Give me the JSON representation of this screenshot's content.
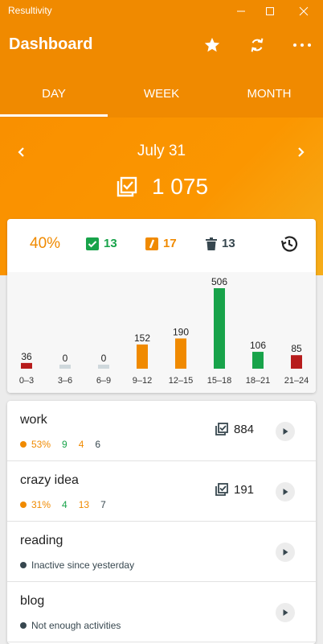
{
  "window": {
    "title": "Resultivity"
  },
  "header": {
    "title": "Dashboard",
    "actions": [
      "star-icon",
      "sync-icon",
      "more-icon"
    ]
  },
  "tabs": [
    {
      "label": "DAY",
      "active": true
    },
    {
      "label": "WEEK",
      "active": false
    },
    {
      "label": "MONTH",
      "active": false
    }
  ],
  "summary": {
    "date": "July 31",
    "total": "1 075"
  },
  "stats": {
    "percent": "40%",
    "done": "13",
    "late": "17",
    "deleted": "13"
  },
  "colors": {
    "accent": "#f08a00",
    "green": "#18a34a",
    "red": "#b71c1c",
    "zero": "#cfd8dc",
    "dark": "#37474f"
  },
  "chart_data": {
    "type": "bar",
    "categories": [
      "0–3",
      "3–6",
      "6–9",
      "9–12",
      "12–15",
      "15–18",
      "18–21",
      "21–24"
    ],
    "values": [
      36,
      0,
      0,
      152,
      190,
      506,
      106,
      85
    ],
    "value_labels": [
      "36",
      "0",
      "0",
      "152",
      "190",
      "506",
      "106",
      "85"
    ],
    "bar_colors": [
      "#b71c1c",
      "#cfd8dc",
      "#cfd8dc",
      "#f08a00",
      "#f08a00",
      "#18a34a",
      "#18a34a",
      "#b71c1c"
    ],
    "ylim": [
      0,
      506
    ]
  },
  "activities": [
    {
      "name": "work",
      "sub_type": "stats",
      "dot_color": "#f08a00",
      "percent": "53%",
      "done": "9",
      "late": "4",
      "deleted": "6",
      "count": "884"
    },
    {
      "name": "crazy idea",
      "sub_type": "stats",
      "dot_color": "#f08a00",
      "percent": "31%",
      "done": "4",
      "late": "13",
      "deleted": "7",
      "count": "191"
    },
    {
      "name": "reading",
      "sub_type": "note",
      "dot_color": "#37474f",
      "note": "Inactive since yesterday"
    },
    {
      "name": "blog",
      "sub_type": "note",
      "dot_color": "#37474f",
      "note": "Not enough activities"
    }
  ]
}
